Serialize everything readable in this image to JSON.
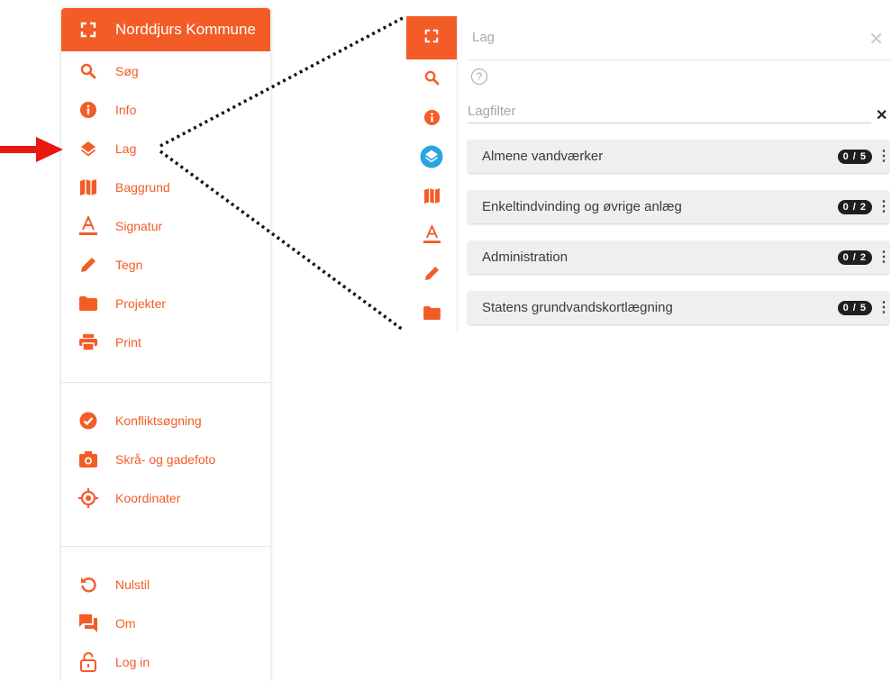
{
  "app": {
    "title": "Norddjurs Kommune",
    "colors": {
      "accent": "#f35c27",
      "active": "#29a3e0",
      "arrow": "#e8180f"
    }
  },
  "menu": {
    "items": [
      {
        "label": "Søg",
        "icon": "search-icon"
      },
      {
        "label": "Info",
        "icon": "info-icon"
      },
      {
        "label": "Lag",
        "icon": "layers-icon"
      },
      {
        "label": "Baggrund",
        "icon": "map-icon"
      },
      {
        "label": "Signatur",
        "icon": "text-color-icon"
      },
      {
        "label": "Tegn",
        "icon": "pencil-icon"
      },
      {
        "label": "Projekter",
        "icon": "folder-icon"
      },
      {
        "label": "Print",
        "icon": "print-icon"
      },
      {
        "label": "Konfliktsøgning",
        "icon": "check-circle-icon"
      },
      {
        "label": "Skrå- og gadefoto",
        "icon": "camera-icon"
      },
      {
        "label": "Koordinater",
        "icon": "crosshair-icon"
      },
      {
        "label": "Nulstil",
        "icon": "reset-icon"
      },
      {
        "label": "Om",
        "icon": "chat-icon"
      },
      {
        "label": "Log in",
        "icon": "lock-icon"
      }
    ]
  },
  "layers_panel": {
    "title": "Lag",
    "filter_placeholder": "Lagfilter",
    "groups": [
      {
        "name": "Almene vandværker",
        "count": "0 / 5"
      },
      {
        "name": "Enkeltindvinding og øvrige anlæg",
        "count": "0 / 2"
      },
      {
        "name": "Administration",
        "count": "0 / 2"
      },
      {
        "name": "Statens grundvandskortlægning",
        "count": "0 / 5"
      }
    ]
  }
}
